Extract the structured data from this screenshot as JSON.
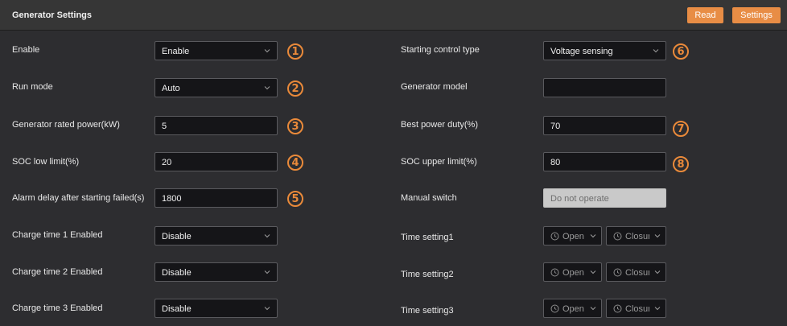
{
  "header": {
    "title": "Generator Settings",
    "read_label": "Read",
    "settings_label": "Settings"
  },
  "colors": {
    "accent": "#e88d45",
    "background": "#2d2d30",
    "field_bg": "#151518"
  },
  "left": [
    {
      "label": "Enable",
      "value": "Enable",
      "type": "select",
      "badge": "1"
    },
    {
      "label": "Run mode",
      "value": "Auto",
      "type": "select",
      "badge": "2"
    },
    {
      "label": "Generator rated power(kW)",
      "value": "5",
      "type": "input",
      "badge": "3"
    },
    {
      "label": "SOC low limit(%)",
      "value": "20",
      "type": "input",
      "badge": "4"
    },
    {
      "label": "Alarm delay after starting failed(s)",
      "value": "1800",
      "type": "input",
      "badge": "5"
    },
    {
      "label": "Charge time 1 Enabled",
      "value": "Disable",
      "type": "select"
    },
    {
      "label": "Charge time 2 Enabled",
      "value": "Disable",
      "type": "select"
    },
    {
      "label": "Charge time 3 Enabled",
      "value": "Disable",
      "type": "select"
    }
  ],
  "right": [
    {
      "label": "Starting control type",
      "value": "Voltage sensing",
      "type": "select",
      "badge": "6"
    },
    {
      "label": "Generator model",
      "value": "",
      "type": "input"
    },
    {
      "label": "Best power duty(%)",
      "value": "70",
      "type": "input",
      "badge": "7"
    },
    {
      "label": "SOC upper limit(%)",
      "value": "80",
      "type": "input",
      "badge": "8"
    },
    {
      "label": "Manual switch",
      "value": "Do not operate",
      "type": "disabled"
    },
    {
      "label": "Time setting1",
      "open": "Open",
      "closure": "Closure"
    },
    {
      "label": "Time setting2",
      "open": "Open",
      "closure": "Closure"
    },
    {
      "label": "Time setting3",
      "open": "Open",
      "closure": "Closure"
    }
  ]
}
